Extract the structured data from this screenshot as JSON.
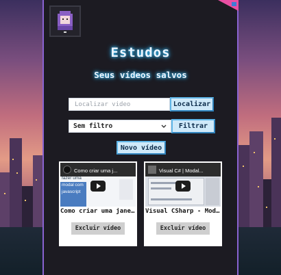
{
  "page": {
    "title": "Estudos",
    "subtitle": "Seus vídeos salvos"
  },
  "search": {
    "placeholder": "Localizar video",
    "button_label": "Localizar"
  },
  "filter": {
    "selected": "Sem filtro",
    "button_label": "Filtrar"
  },
  "new_video_label": "Novo vídeo",
  "videos": [
    {
      "title": "Como criar uma janela",
      "thumb_title": "Como criar uma j...",
      "thumb_lines": [
        "fazer uma",
        "modal com",
        "javascript"
      ],
      "delete_label": "Excluir vídeo"
    },
    {
      "title": "Visual CSharp - Modal",
      "thumb_title": "Visual C# | Modal...",
      "delete_label": "Excluir vídeo"
    }
  ],
  "colors": {
    "panel": "#1c1b22",
    "border": "#8a63d2",
    "accent_glow": "#3ec6ff",
    "button_bg": "#cfe9f9",
    "button_border": "#5fb6e8"
  }
}
